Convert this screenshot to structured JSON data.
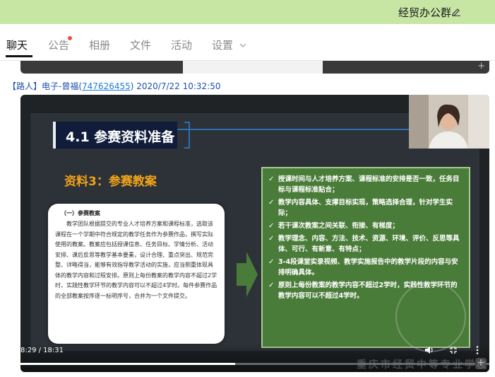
{
  "header": {
    "group_name": "经贸办公群"
  },
  "tabs": [
    {
      "label": "聊天",
      "active": true
    },
    {
      "label": "公告",
      "has_dot": true
    },
    {
      "label": "相册"
    },
    {
      "label": "文件"
    },
    {
      "label": "活动"
    },
    {
      "label": "设置"
    }
  ],
  "message": {
    "sender": "【路人】电子-曾福",
    "qq": "747626455",
    "timestamp": "2020/7/22 10:32:50"
  },
  "slide": {
    "title": "4.1 参赛资料准备",
    "subtitle": "资料3：参赛教案",
    "doc_heading": "（一）参赛教案",
    "doc_body": "教学团队根据提交的专业人才培养方案和课程标准，选取该课程在一个学期中符合规定的教学任务作为参赛作品，撰写实际使用的教案。教案应包括授课信息、任务目标、学情分析、活动安排、课后反思等教学基本要素，设计合理、重点突出、规范完整、详略得当，能够有效指导教学活动的实施，应当侧重体现具体的教学内容和过程安排。原则上每份教案的教学内容不超过2学时，实践性教学环节的教学内容可以不超过4学时。每件参赛作品的全部教案按序逐一标明序号，合并为一个文件提交。",
    "bullets": [
      "授课时间与人才培养方案、课程标准的安排是否一致，任务目标与课程标准贴合；",
      "教学内容具体、支撑目标实现，策略选择合理，针对学生实际；",
      "若干课次教案之间关联、衔接、有梯度；",
      "教学理念、内容、方法、技术、资源、环境、评价、反思等具体、可行、有新意、有特点；",
      "3-4段课堂实录视频、教学实施报告中的教学片段的内容与安排明确具体。",
      "原则上每份教案的教学内容不超过2学时，实践性教学环节的教学内容可以不超过4学时。"
    ]
  },
  "player": {
    "time": "8:29 / 18:31",
    "progress": 0.458
  },
  "watermark": "重庆市经贸中等专业学校",
  "colors": {
    "topbar": "#c7e6a4",
    "link": "#1f7bd8",
    "slide_title_bg": "#101c3a",
    "subtitle": "#f0a319",
    "green_box": "#4a7c39"
  }
}
